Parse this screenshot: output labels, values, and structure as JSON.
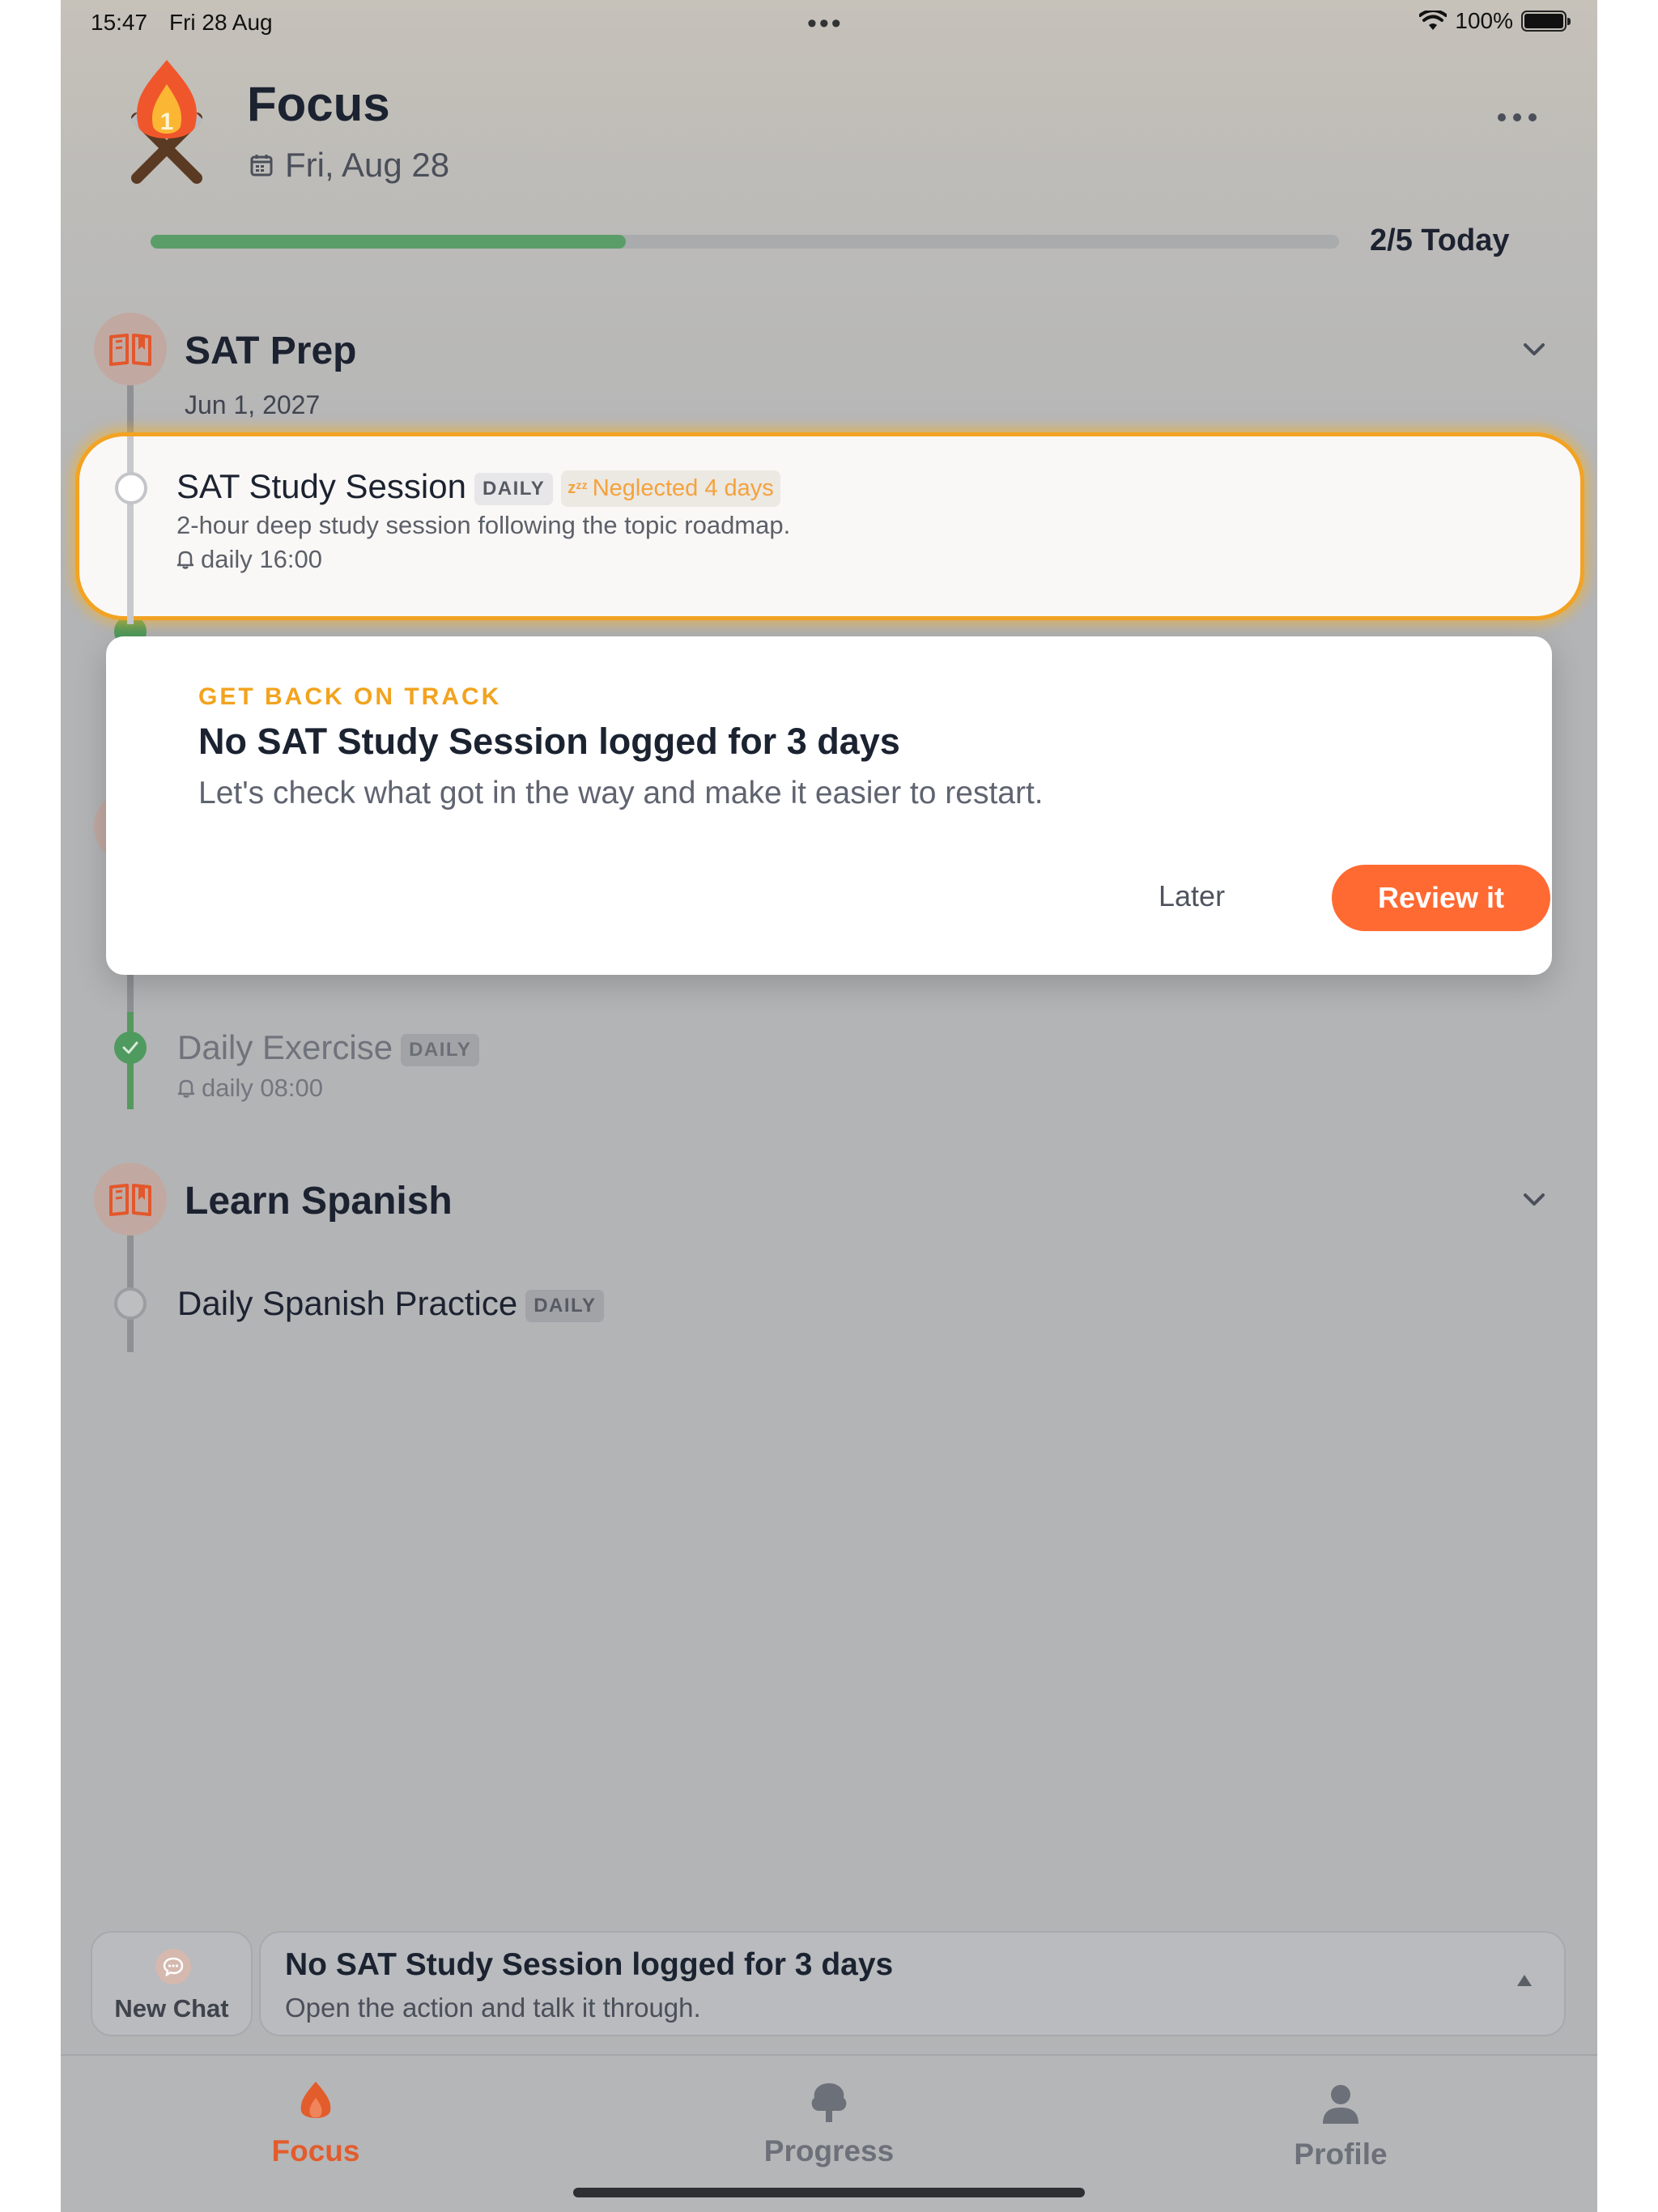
{
  "status_bar": {
    "time": "15:47",
    "date": "Fri 28 Aug",
    "battery": "100%"
  },
  "header": {
    "title": "Focus",
    "date": "Fri, Aug 28"
  },
  "progress": {
    "fraction": 0.4,
    "label": "2/5 Today"
  },
  "sections": [
    {
      "title": "SAT Prep",
      "date": "Jun 1, 2027",
      "tasks": [
        {
          "title": "SAT Study Session",
          "badge": "DAILY",
          "neglect": "Neglected 4 days",
          "description": "2-hour deep study session following the topic roadmap.",
          "reminder": "daily 16:00"
        }
      ]
    },
    {
      "title": "",
      "tasks": [
        {
          "title": "Daily Exercise",
          "badge": "DAILY",
          "reminder": "daily 08:00",
          "done": true
        }
      ]
    },
    {
      "title": "Learn Spanish",
      "tasks": [
        {
          "title": "Daily Spanish Practice",
          "badge": "DAILY"
        }
      ]
    }
  ],
  "modal": {
    "eyebrow": "GET BACK ON TRACK",
    "headline": "No SAT Study Session logged for 3 days",
    "body": "Let's check what got in the way and make it easier to restart.",
    "later_label": "Later",
    "review_label": "Review it"
  },
  "chat": {
    "new_chat_label": "New Chat",
    "title": "No SAT Study Session logged for 3 days",
    "subtitle": "Open the action and talk it through."
  },
  "tabs": [
    {
      "label": "Focus",
      "active": true
    },
    {
      "label": "Progress"
    },
    {
      "label": "Profile"
    }
  ],
  "colors": {
    "accent": "#ff6a33",
    "warning": "#f2a31e",
    "success": "#5a9d68"
  }
}
